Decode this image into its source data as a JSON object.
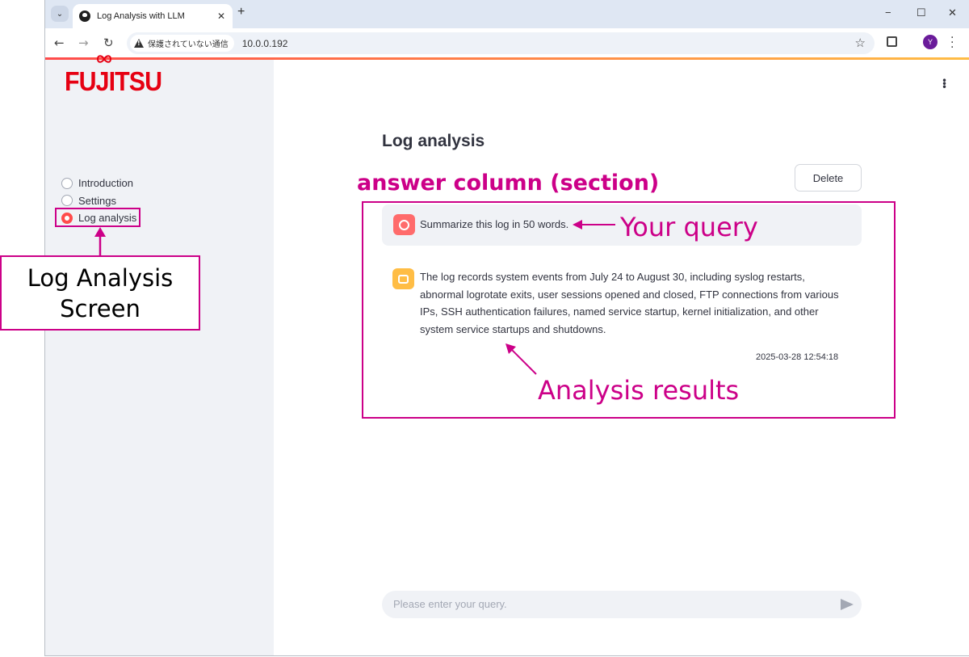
{
  "browser": {
    "tab_title": "Log Analysis with LLM",
    "tab_close": "✕",
    "new_tab": "+",
    "security_text": "保護されていない通信",
    "url": "10.0.0.192",
    "profile_initial": "Y",
    "window_controls": {
      "minimize": "−",
      "maximize": "☐",
      "close": "✕"
    }
  },
  "app": {
    "logo_text": "FUJITSU",
    "sidebar": {
      "items": [
        {
          "label": "Introduction",
          "selected": false
        },
        {
          "label": "Settings",
          "selected": false
        },
        {
          "label": "Log analysis",
          "selected": true
        }
      ]
    },
    "main": {
      "title": "Log analysis",
      "delete_label": "Delete",
      "user_message": "Summarize this log in 50 words.",
      "assistant_message": "The log records system events from July 24 to August 30, including syslog restarts, abnormal logrotate exits, user sessions opened and closed, FTP connections from various IPs, SSH authentication failures, named service startup, kernel initialization, and other system service startups and shutdowns.",
      "timestamp": "2025-03-28 12:54:18",
      "input_placeholder": "Please enter your query."
    }
  },
  "annotations": {
    "answer_column": "answer column (section)",
    "your_query": "Your query",
    "analysis_results": "Analysis results",
    "log_analysis_screen_line1": "Log Analysis",
    "log_analysis_screen_line2": "Screen"
  },
  "colors": {
    "accent": "#ff4b4b",
    "annotation": "#cc0088",
    "brand": "#e60012",
    "sidebar_bg": "#f0f2f6"
  }
}
